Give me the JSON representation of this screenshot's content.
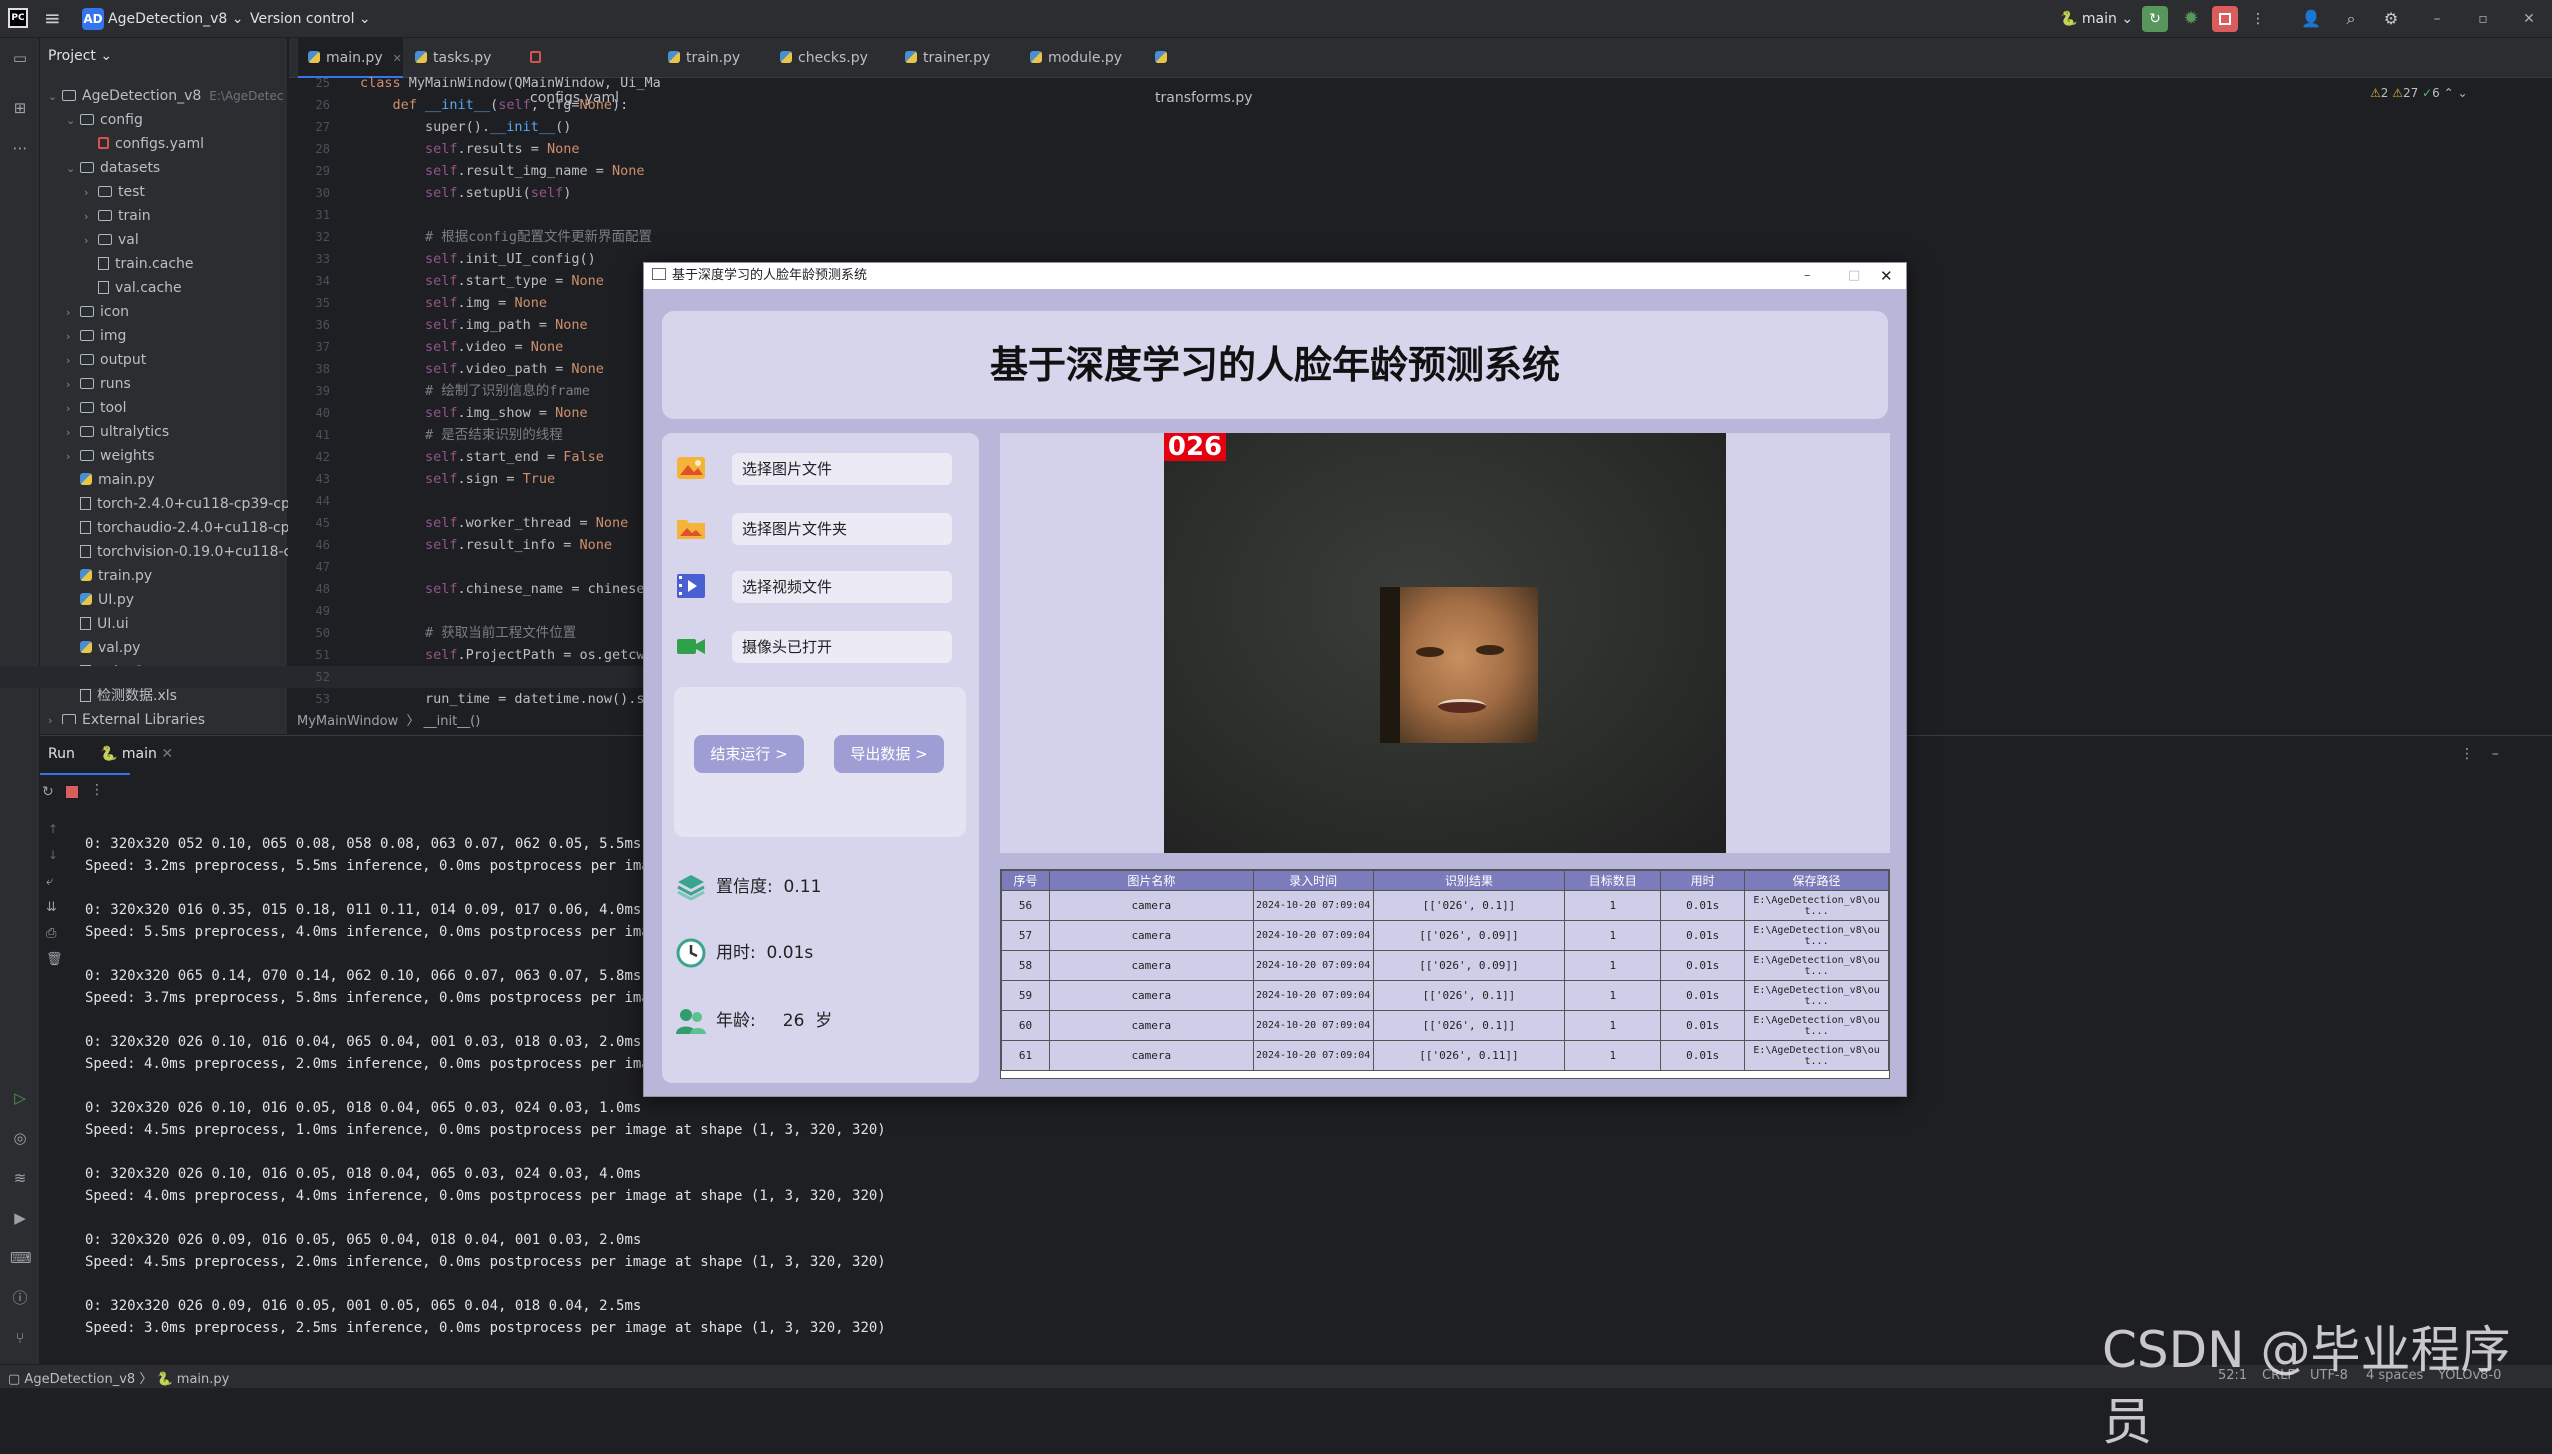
{
  "ide": {
    "project_name": "AgeDetection_v8",
    "vcs_label": "Version control",
    "branch": "main",
    "problems": {
      "warnings": "2",
      "weak_warnings": "27",
      "ok": "6"
    },
    "tabs": [
      "main.py",
      "tasks.py",
      "configs.yaml",
      "train.py",
      "checks.py",
      "trainer.py",
      "module.py",
      "transforms.py"
    ],
    "project_panel_title": "Project",
    "tree": [
      {
        "label": "AgeDetection_v8",
        "suffix": "E:\\AgeDetec",
        "depth": 0,
        "type": "folder",
        "open": true
      },
      {
        "label": "config",
        "depth": 1,
        "type": "folder",
        "open": true
      },
      {
        "label": "configs.yaml",
        "depth": 2,
        "type": "yaml"
      },
      {
        "label": "datasets",
        "depth": 1,
        "type": "folder",
        "open": true
      },
      {
        "label": "test",
        "depth": 2,
        "type": "folder"
      },
      {
        "label": "train",
        "depth": 2,
        "type": "folder"
      },
      {
        "label": "val",
        "depth": 2,
        "type": "folder"
      },
      {
        "label": "train.cache",
        "depth": 2,
        "type": "file"
      },
      {
        "label": "val.cache",
        "depth": 2,
        "type": "file"
      },
      {
        "label": "icon",
        "depth": 1,
        "type": "folder"
      },
      {
        "label": "img",
        "depth": 1,
        "type": "folder"
      },
      {
        "label": "output",
        "depth": 1,
        "type": "folder"
      },
      {
        "label": "runs",
        "depth": 1,
        "type": "folder"
      },
      {
        "label": "tool",
        "depth": 1,
        "type": "folder"
      },
      {
        "label": "ultralytics",
        "depth": 1,
        "type": "folder"
      },
      {
        "label": "weights",
        "depth": 1,
        "type": "folder"
      },
      {
        "label": "main.py",
        "depth": 1,
        "type": "py"
      },
      {
        "label": "torch-2.4.0+cu118-cp39-cp3",
        "depth": 1,
        "type": "file"
      },
      {
        "label": "torchaudio-2.4.0+cu118-cp3",
        "depth": 1,
        "type": "file"
      },
      {
        "label": "torchvision-0.19.0+cu118-cp",
        "depth": 1,
        "type": "file"
      },
      {
        "label": "train.py",
        "depth": 1,
        "type": "py"
      },
      {
        "label": "UI.py",
        "depth": 1,
        "type": "py"
      },
      {
        "label": "UI.ui",
        "depth": 1,
        "type": "file"
      },
      {
        "label": "val.py",
        "depth": 1,
        "type": "py"
      },
      {
        "label": "yolov8n.pt",
        "depth": 1,
        "type": "file"
      },
      {
        "label": "检测数据.xls",
        "depth": 1,
        "type": "file"
      },
      {
        "label": "External Libraries",
        "depth": 0,
        "type": "folder"
      }
    ],
    "code": [
      {
        "n": "25",
        "t": "class MyMainWindow(QMainWindow, Ui_MainWindow):"
      },
      {
        "n": "26",
        "t": "    def __init__(self, cfg=None):"
      },
      {
        "n": "27",
        "t": "        super().__init__()"
      },
      {
        "n": "28",
        "t": "        self.results = None"
      },
      {
        "n": "29",
        "t": "        self.result_img_name = None"
      },
      {
        "n": "30",
        "t": "        self.setupUi(self)"
      },
      {
        "n": "31",
        "t": ""
      },
      {
        "n": "32",
        "t": "        # 根据config配置文件更新界面配置"
      },
      {
        "n": "33",
        "t": "        self.init_UI_config()"
      },
      {
        "n": "34",
        "t": "        self.start_type = None"
      },
      {
        "n": "35",
        "t": "        self.img = None"
      },
      {
        "n": "36",
        "t": "        self.img_path = None"
      },
      {
        "n": "37",
        "t": "        self.video = None"
      },
      {
        "n": "38",
        "t": "        self.video_path = None"
      },
      {
        "n": "39",
        "t": "        # 绘制了识别信息的frame"
      },
      {
        "n": "40",
        "t": "        self.img_show = None"
      },
      {
        "n": "41",
        "t": "        # 是否结束识别的线程"
      },
      {
        "n": "42",
        "t": "        self.start_end = False"
      },
      {
        "n": "43",
        "t": "        self.sign = True"
      },
      {
        "n": "44",
        "t": ""
      },
      {
        "n": "45",
        "t": "        self.worker_thread = None"
      },
      {
        "n": "46",
        "t": "        self.result_info = None"
      },
      {
        "n": "47",
        "t": ""
      },
      {
        "n": "48",
        "t": "        self.chinese_name = chinese"
      },
      {
        "n": "49",
        "t": ""
      },
      {
        "n": "50",
        "t": "        # 获取当前工程文件位置"
      },
      {
        "n": "51",
        "t": "        self.ProjectPath = os.getcw"
      },
      {
        "n": "52",
        "t": ""
      },
      {
        "n": "53",
        "t": "        run_time = datetime.now().s"
      }
    ],
    "breadcrumb": [
      "MyMainWindow",
      "__init__()"
    ],
    "run_tab_label": "Run",
    "run_config": "main",
    "run_output": [
      "0: 320x320 052 0.10, 065 0.08, 058 0.08, 063 0.07, 062 0.05, 5.5ms",
      "Speed: 3.2ms preprocess, 5.5ms inference, 0.0ms postprocess per image",
      "",
      "0: 320x320 016 0.35, 015 0.18, 011 0.11, 014 0.09, 017 0.06, 4.0ms",
      "Speed: 5.5ms preprocess, 4.0ms inference, 0.0ms postprocess per image",
      "",
      "0: 320x320 065 0.14, 070 0.14, 062 0.10, 066 0.07, 063 0.07, 5.8ms",
      "Speed: 3.7ms preprocess, 5.8ms inference, 0.0ms postprocess per image",
      "",
      "0: 320x320 026 0.10, 016 0.04, 065 0.04, 001 0.03, 018 0.03, 2.0ms",
      "Speed: 4.0ms preprocess, 2.0ms inference, 0.0ms postprocess per image",
      "",
      "0: 320x320 026 0.10, 016 0.05, 018 0.04, 065 0.03, 024 0.03, 1.0ms",
      "Speed: 4.5ms preprocess, 1.0ms inference, 0.0ms postprocess per image at shape (1, 3, 320, 320)",
      "",
      "0: 320x320 026 0.10, 016 0.05, 018 0.04, 065 0.03, 024 0.03, 4.0ms",
      "Speed: 4.0ms preprocess, 4.0ms inference, 0.0ms postprocess per image at shape (1, 3, 320, 320)",
      "",
      "0: 320x320 026 0.09, 016 0.05, 065 0.04, 018 0.04, 001 0.03, 2.0ms",
      "Speed: 4.5ms preprocess, 2.0ms inference, 0.0ms postprocess per image at shape (1, 3, 320, 320)",
      "",
      "0: 320x320 026 0.09, 016 0.05, 001 0.05, 065 0.04, 018 0.04, 2.5ms",
      "Speed: 3.0ms preprocess, 2.5ms inference, 0.0ms postprocess per image at shape (1, 3, 320, 320)"
    ],
    "status": {
      "path1": "AgeDetection_v8",
      "path2": "main.py",
      "position": "52:1",
      "line_sep": "CRLF",
      "encoding": "UTF-8",
      "indent": "4 spaces",
      "interpreter": "YOLOv8-0"
    }
  },
  "app": {
    "window_title": "基于深度学习的人脸年龄预测系统",
    "heading": "基于深度学习的人脸年龄预测系统",
    "options": [
      {
        "label": "选择图片文件",
        "icon": "image-icon"
      },
      {
        "label": "选择图片文件夹",
        "icon": "folder-image-icon"
      },
      {
        "label": "选择视频文件",
        "icon": "video-file-icon"
      },
      {
        "label": "摄像头已打开",
        "icon": "camera-icon"
      }
    ],
    "stop_button": "结束运行 >",
    "export_button": "导出数据 >",
    "confidence_label": "置信度:",
    "confidence_value": "0.11",
    "time_label": "用时:",
    "time_value": "0.01s",
    "age_label": "年龄:",
    "age_value": "26",
    "age_unit": "岁",
    "detected_age_tag": "026",
    "table": {
      "headers": [
        "序号",
        "图片名称",
        "录入时间",
        "识别结果",
        "目标数目",
        "用时",
        "保存路径"
      ],
      "rows": [
        [
          "56",
          "camera",
          "2024-10-20 07:09:04",
          "[['026', 0.1]]",
          "1",
          "0.01s",
          "E:\\AgeDetection_v8\\out..."
        ],
        [
          "57",
          "camera",
          "2024-10-20 07:09:04",
          "[['026', 0.09]]",
          "1",
          "0.01s",
          "E:\\AgeDetection_v8\\out..."
        ],
        [
          "58",
          "camera",
          "2024-10-20 07:09:04",
          "[['026', 0.09]]",
          "1",
          "0.01s",
          "E:\\AgeDetection_v8\\out..."
        ],
        [
          "59",
          "camera",
          "2024-10-20 07:09:04",
          "[['026', 0.1]]",
          "1",
          "0.01s",
          "E:\\AgeDetection_v8\\out..."
        ],
        [
          "60",
          "camera",
          "2024-10-20 07:09:04",
          "[['026', 0.1]]",
          "1",
          "0.01s",
          "E:\\AgeDetection_v8\\out..."
        ],
        [
          "61",
          "camera",
          "2024-10-20 07:09:04",
          "[['026', 0.11]]",
          "1",
          "0.01s",
          "E:\\AgeDetection_v8\\out..."
        ]
      ]
    }
  },
  "watermark": "CSDN @毕业程序员"
}
